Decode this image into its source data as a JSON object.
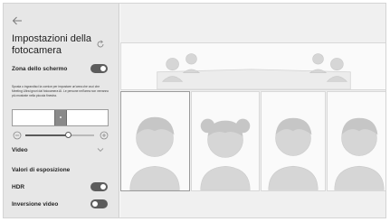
{
  "settings": {
    "title": "Impostazioni della fotocamera",
    "screen_area": {
      "label": "Zona dello schermo",
      "enabled": true,
      "description": "Sposta o ingrandisci la cornice per impostare un'area che vuoi che Meeting Ultra ignori dal fotocamera AI. Le persone nell'area non verranno più mostrate nella piccola finestra."
    },
    "zoom": {
      "level": 0.62
    },
    "video_label": "Video",
    "exposure_label": "Valori di esposizione",
    "hdr": {
      "label": "HDR",
      "enabled": true
    },
    "mirror": {
      "label": "Inversione video",
      "enabled": false
    }
  },
  "icons": {
    "back": "back-arrow-icon",
    "reset": "reset-icon",
    "zoom_out": "zoom-out-icon",
    "zoom_in": "zoom-in-icon",
    "expand": "chevron-down-icon"
  },
  "gallery": {
    "top_strip_people": 4,
    "tiles": [
      "person-short-hair",
      "person-bun-hair",
      "person-short-hair",
      "person-short-hair"
    ]
  },
  "colors": {
    "panel_bg": "#e7e7e7",
    "toggle_on": "#5c5c5c",
    "avatar": "#d6d6d6"
  }
}
